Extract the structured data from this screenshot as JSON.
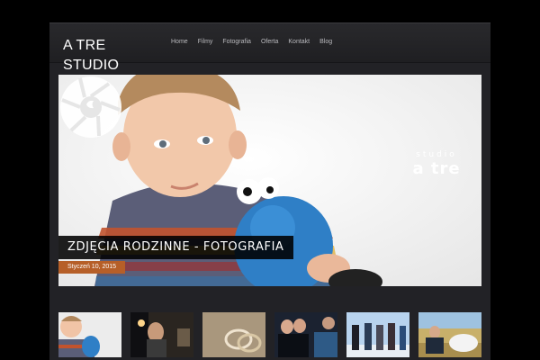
{
  "site": {
    "logo_line1": "A TRE",
    "logo_line2": "STUDIO"
  },
  "nav": {
    "items": [
      {
        "label": "Home"
      },
      {
        "label": "Filmy"
      },
      {
        "label": "Fotografia"
      },
      {
        "label": "Oferta"
      },
      {
        "label": "Kontakt"
      },
      {
        "label": "Blog"
      }
    ]
  },
  "hero": {
    "watermark_small": "studio",
    "watermark_big": "a tre",
    "post_title": "ZDJĘCIA RODZINNE - FOTOGRAFIA",
    "post_date": "Styczeń 10, 2015"
  },
  "colors": {
    "background": "#000000",
    "panel": "#222226",
    "accent": "#b65f28"
  }
}
